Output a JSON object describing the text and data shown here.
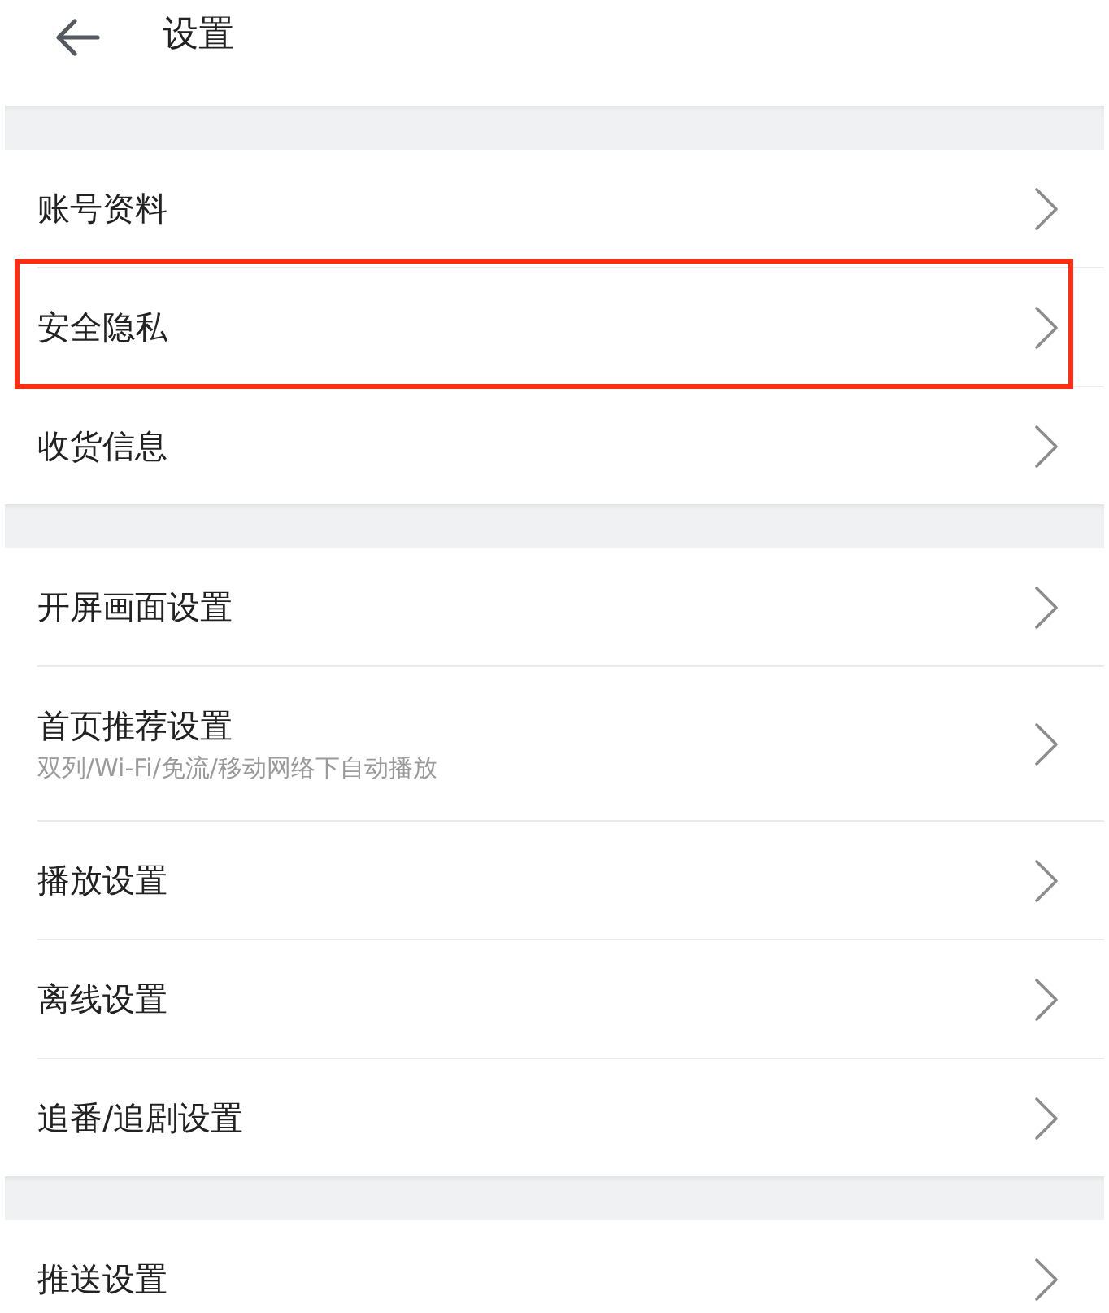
{
  "header": {
    "title": "设置"
  },
  "groups": [
    {
      "items": [
        {
          "label": "账号资料",
          "highlighted": false
        },
        {
          "label": "安全隐私",
          "highlighted": true
        },
        {
          "label": "收货信息",
          "highlighted": false
        }
      ]
    },
    {
      "items": [
        {
          "label": "开屏画面设置",
          "highlighted": false
        },
        {
          "label": "首页推荐设置",
          "subtitle": "双列/Wi-Fi/免流/移动网络下自动播放",
          "highlighted": false
        },
        {
          "label": "播放设置",
          "highlighted": false
        },
        {
          "label": "离线设置",
          "highlighted": false
        },
        {
          "label": "追番/追剧设置",
          "highlighted": false
        }
      ]
    },
    {
      "items": [
        {
          "label": "推送设置",
          "highlighted": false
        }
      ]
    }
  ]
}
